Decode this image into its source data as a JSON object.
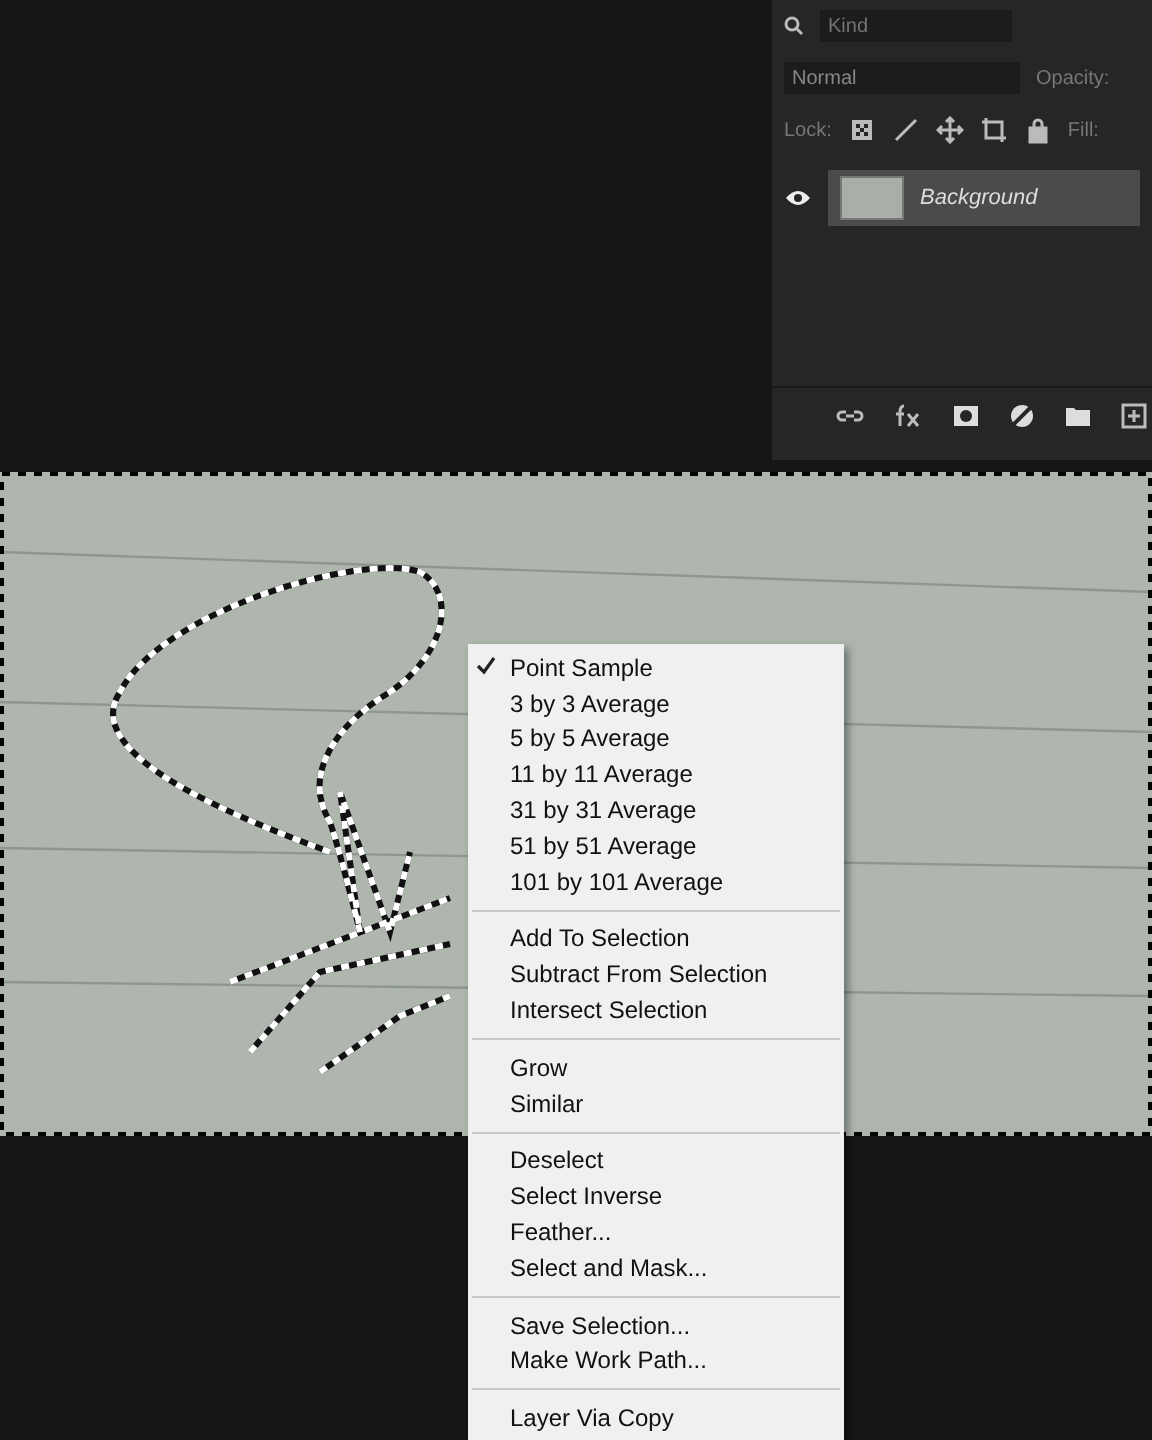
{
  "layers_panel": {
    "search": {
      "placeholder": "Kind"
    },
    "blend_mode": "Normal",
    "opacity_label": "Opacity:",
    "lock_label": "Lock:",
    "fill_label": "Fill:",
    "layers": [
      {
        "name": "Background",
        "visible": true,
        "selected": true
      }
    ]
  },
  "context_menu": {
    "groups": [
      [
        {
          "label": "Point Sample",
          "checked": true
        },
        {
          "label": "3 by 3 Average",
          "checked": false
        },
        {
          "label": "5 by 5 Average",
          "checked": false
        },
        {
          "label": "11 by 11 Average",
          "checked": false
        },
        {
          "label": "31 by 31 Average",
          "checked": false
        },
        {
          "label": "51 by 51 Average",
          "checked": false
        },
        {
          "label": "101 by 101 Average",
          "checked": false
        }
      ],
      [
        {
          "label": "Add To Selection",
          "checked": false
        },
        {
          "label": "Subtract From Selection",
          "checked": false
        },
        {
          "label": "Intersect Selection",
          "checked": false
        }
      ],
      [
        {
          "label": "Grow",
          "checked": false
        },
        {
          "label": "Similar",
          "checked": false
        }
      ],
      [
        {
          "label": "Deselect",
          "checked": false
        },
        {
          "label": "Select Inverse",
          "checked": false
        },
        {
          "label": "Feather...",
          "checked": false
        },
        {
          "label": "Select and Mask...",
          "checked": false
        }
      ],
      [
        {
          "label": "Save Selection...",
          "checked": false
        },
        {
          "label": "Make Work Path...",
          "checked": false
        }
      ],
      [
        {
          "label": "Layer Via Copy",
          "checked": false
        }
      ]
    ]
  }
}
